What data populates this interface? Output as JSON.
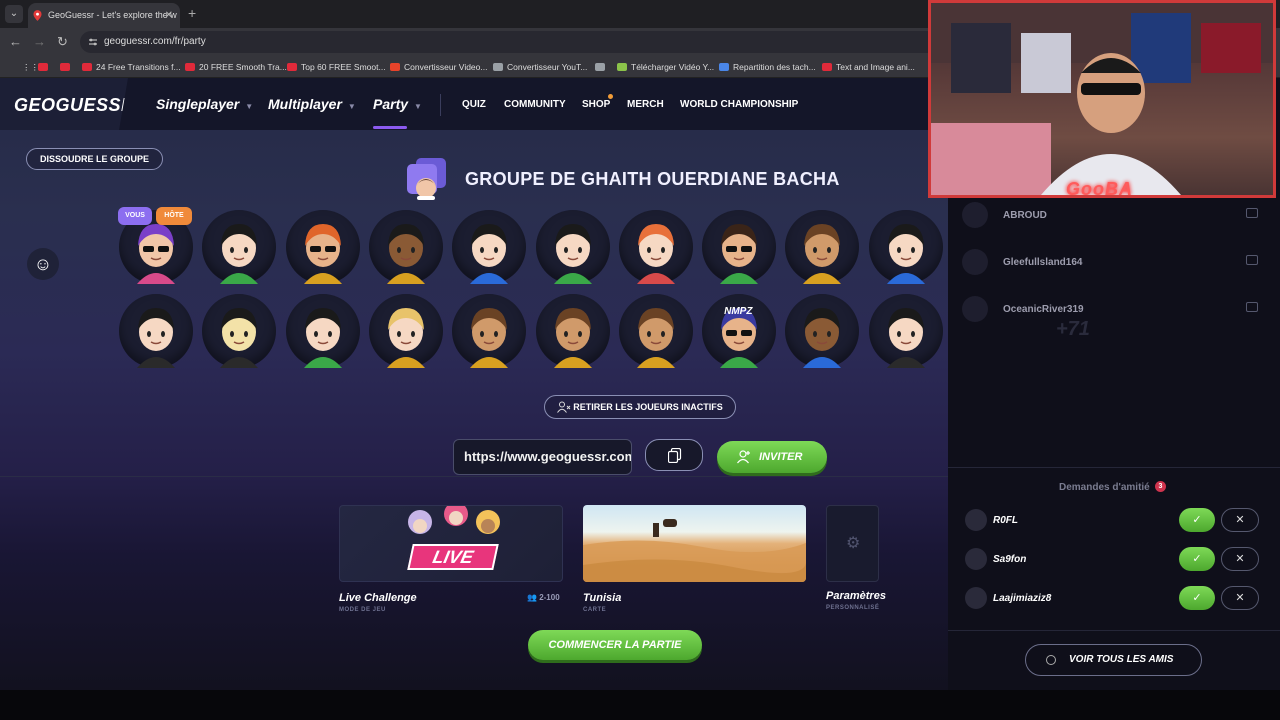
{
  "browser": {
    "tab_title": "GeoGuessr - Let's explore the w",
    "tab_menu_icon": "chevron-down-icon",
    "new_tab_symbol": "+",
    "url": "geoguessr.com/fr/party",
    "bookmarks": [
      {
        "label": "",
        "color": "#e02a3a"
      },
      {
        "label": "",
        "color": "#e02a3a"
      },
      {
        "label": "24 Free Transitions f...",
        "color": "#e02a3a"
      },
      {
        "label": "20 FREE Smooth Tra...",
        "color": "#e02a3a"
      },
      {
        "label": "Top 60 FREE Smoot...",
        "color": "#e02a3a"
      },
      {
        "label": "Convertisseur Video...",
        "color": "#e8432a"
      },
      {
        "label": "Convertisseur YouT...",
        "color": "#9aa0a6"
      },
      {
        "label": "",
        "color": "#9aa0a6"
      },
      {
        "label": "Télécharger Vidéo Y...",
        "color": "#8bc34a"
      },
      {
        "label": "Repartition des tach...",
        "color": "#4a86e8"
      },
      {
        "label": "Text and Image ani...",
        "color": "#e02a3a"
      }
    ]
  },
  "site": {
    "logo": "GEOGUESSR",
    "nav_main": [
      "Singleplayer",
      "Multiplayer",
      "Party"
    ],
    "nav_sub": [
      "QUIZ",
      "COMMUNITY",
      "SHOP",
      "MERCH",
      "WORLD CHAMPIONSHIP"
    ],
    "accent": "#8c5bf0",
    "dissolve_label": "DISSOUDRE LE GROUPE",
    "group_title": "GROUPE DE GHAITH OUERDIANE BACHA",
    "badge_you": "VOUS",
    "badge_host": "HÔTE",
    "avatar_tag": "NMPZ",
    "kick_label": "RETIRER LES JOUEURS INACTIFS",
    "invite_link": "https://www.geoguessr.com/join/",
    "invite_label": "INVITER",
    "cards": {
      "live_banner": "LIVE",
      "live_title": "Live Challenge",
      "live_sub": "MODE DE JEU",
      "players": "2-100",
      "map_title": "Tunisia",
      "map_sub": "CARTE",
      "settings_title": "Paramètres",
      "settings_sub": "PERSONNALISÉ"
    },
    "start_label": "COMMENCER LA PARTIE"
  },
  "friends": {
    "list": [
      "ABROUD",
      "Gleefullsland164",
      "OceanicRiver319"
    ],
    "faded_count": "+71",
    "requests_title": "Demandes d'amitié",
    "requests_count": "3",
    "requests": [
      "R0FL",
      "Sa9fon",
      "Laajimiaziz8"
    ],
    "accept_symbol": "✓",
    "reject_symbol": "✕",
    "all_friends_label": "VOIR TOUS LES AMIS"
  },
  "webcam": {
    "name": "GooBA"
  }
}
